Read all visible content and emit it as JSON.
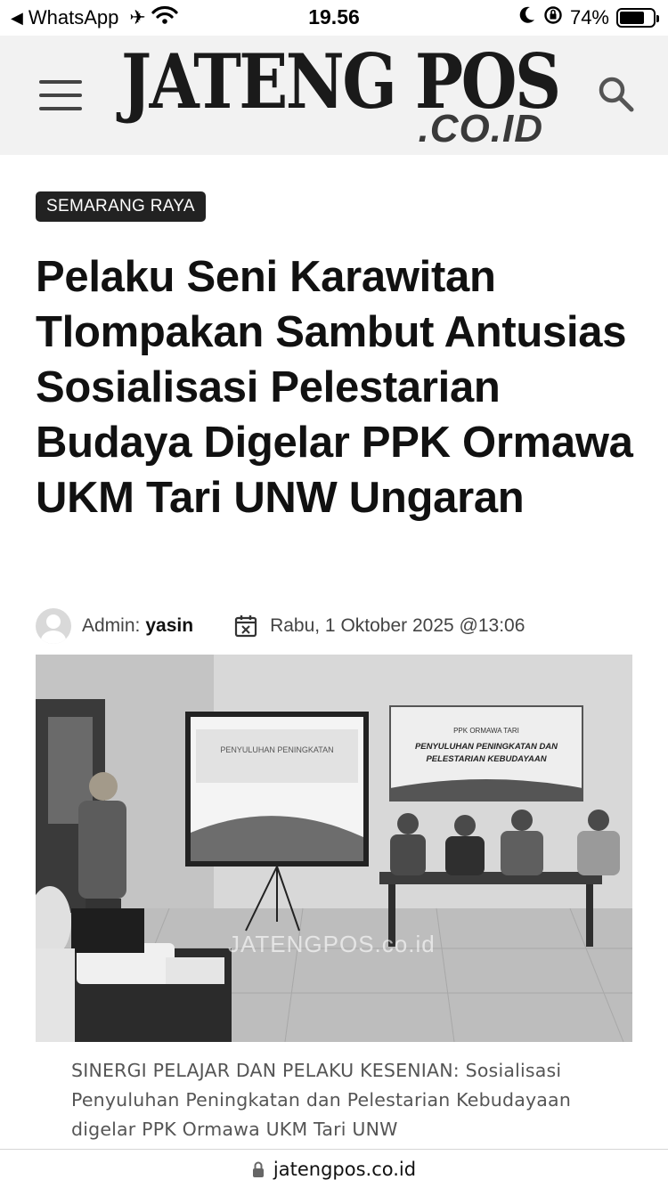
{
  "status_bar": {
    "back_app": "WhatsApp",
    "time": "19.56",
    "battery_percent": "74%",
    "battery_level": 0.74
  },
  "header": {
    "logo_main": "JATENG POS",
    "logo_sub": ".CO.ID",
    "menu_icon": "hamburger-icon",
    "search_icon": "search-icon"
  },
  "article": {
    "category": "SEMARANG RAYA",
    "title": "Pelaku Seni Karawitan Tlompakan Sambut Antusias Sosialisasi Pelestarian Budaya Digelar PPK Ormawa UKM Tari UNW Ungaran",
    "author_prefix": "Admin:",
    "author_name": "yasin",
    "date": "Rabu, 1 Oktober 2025 @13:06",
    "photo": {
      "watermark": "JATENGPOS.co.id",
      "banner_title": "PPK ORMAWA TARI",
      "banner_text": "PENYULUHAN PENINGKATAN DAN PELESTARIAN KEBUDAYAAN"
    },
    "caption": "SINERGI PELAJAR DAN PELAKU KESENIAN: Sosialisasi Penyuluhan Peningkatan dan Pelestarian Kebudayaan digelar PPK Ormawa UKM Tari UNW"
  },
  "url_bar": {
    "domain": "jatengpos.co.id",
    "lock_icon": "lock-icon"
  },
  "colors": {
    "header_bg": "#f2f2f2",
    "category_bg": "#222222",
    "title_text": "#111111",
    "caption_text": "#555555"
  }
}
